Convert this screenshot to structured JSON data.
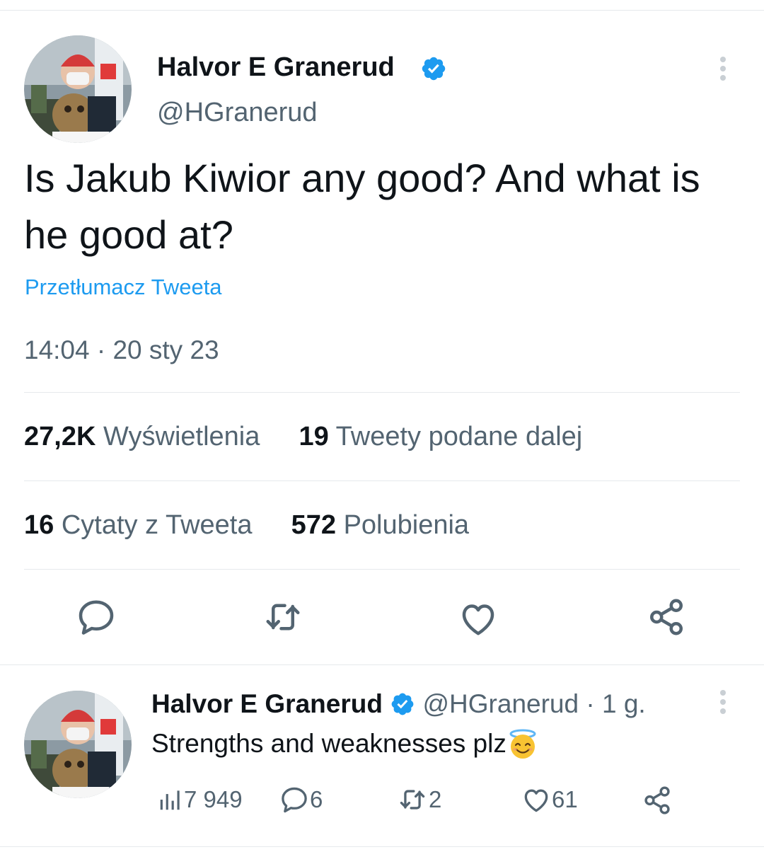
{
  "tweet": {
    "author": {
      "name": "Halvor E Granerud",
      "handle": "@HGranerud",
      "verified": true
    },
    "text": "Is Jakub Kiwior any good? And what is he good at?",
    "translate_link": "Przetłumacz Tweeta",
    "timestamp": "14:04 · 20 sty 23",
    "stats": {
      "views_count": "27,2K",
      "views_label": "Wyświetlenia",
      "retweets_count": "19",
      "retweets_label": "Tweety podane dalej",
      "quotes_count": "16",
      "quotes_label": "Cytaty z Tweeta",
      "likes_count": "572",
      "likes_label": "Polubienia"
    },
    "actions": [
      "reply-icon",
      "retweet-icon",
      "like-icon",
      "share-icon"
    ]
  },
  "reply": {
    "author": {
      "name": "Halvor E Granerud",
      "handle": "@HGranerud",
      "verified": true
    },
    "time": "· 1 g.",
    "text": "Strengths and weaknesses plz",
    "emoji": "😇",
    "views": "7 949",
    "replies": "6",
    "retweets": "2",
    "likes": "61"
  },
  "colors": {
    "verified": "#1d9bf0",
    "link": "#1d9bf0",
    "secondary_text": "#536471",
    "divider": "#e6e9ec"
  }
}
